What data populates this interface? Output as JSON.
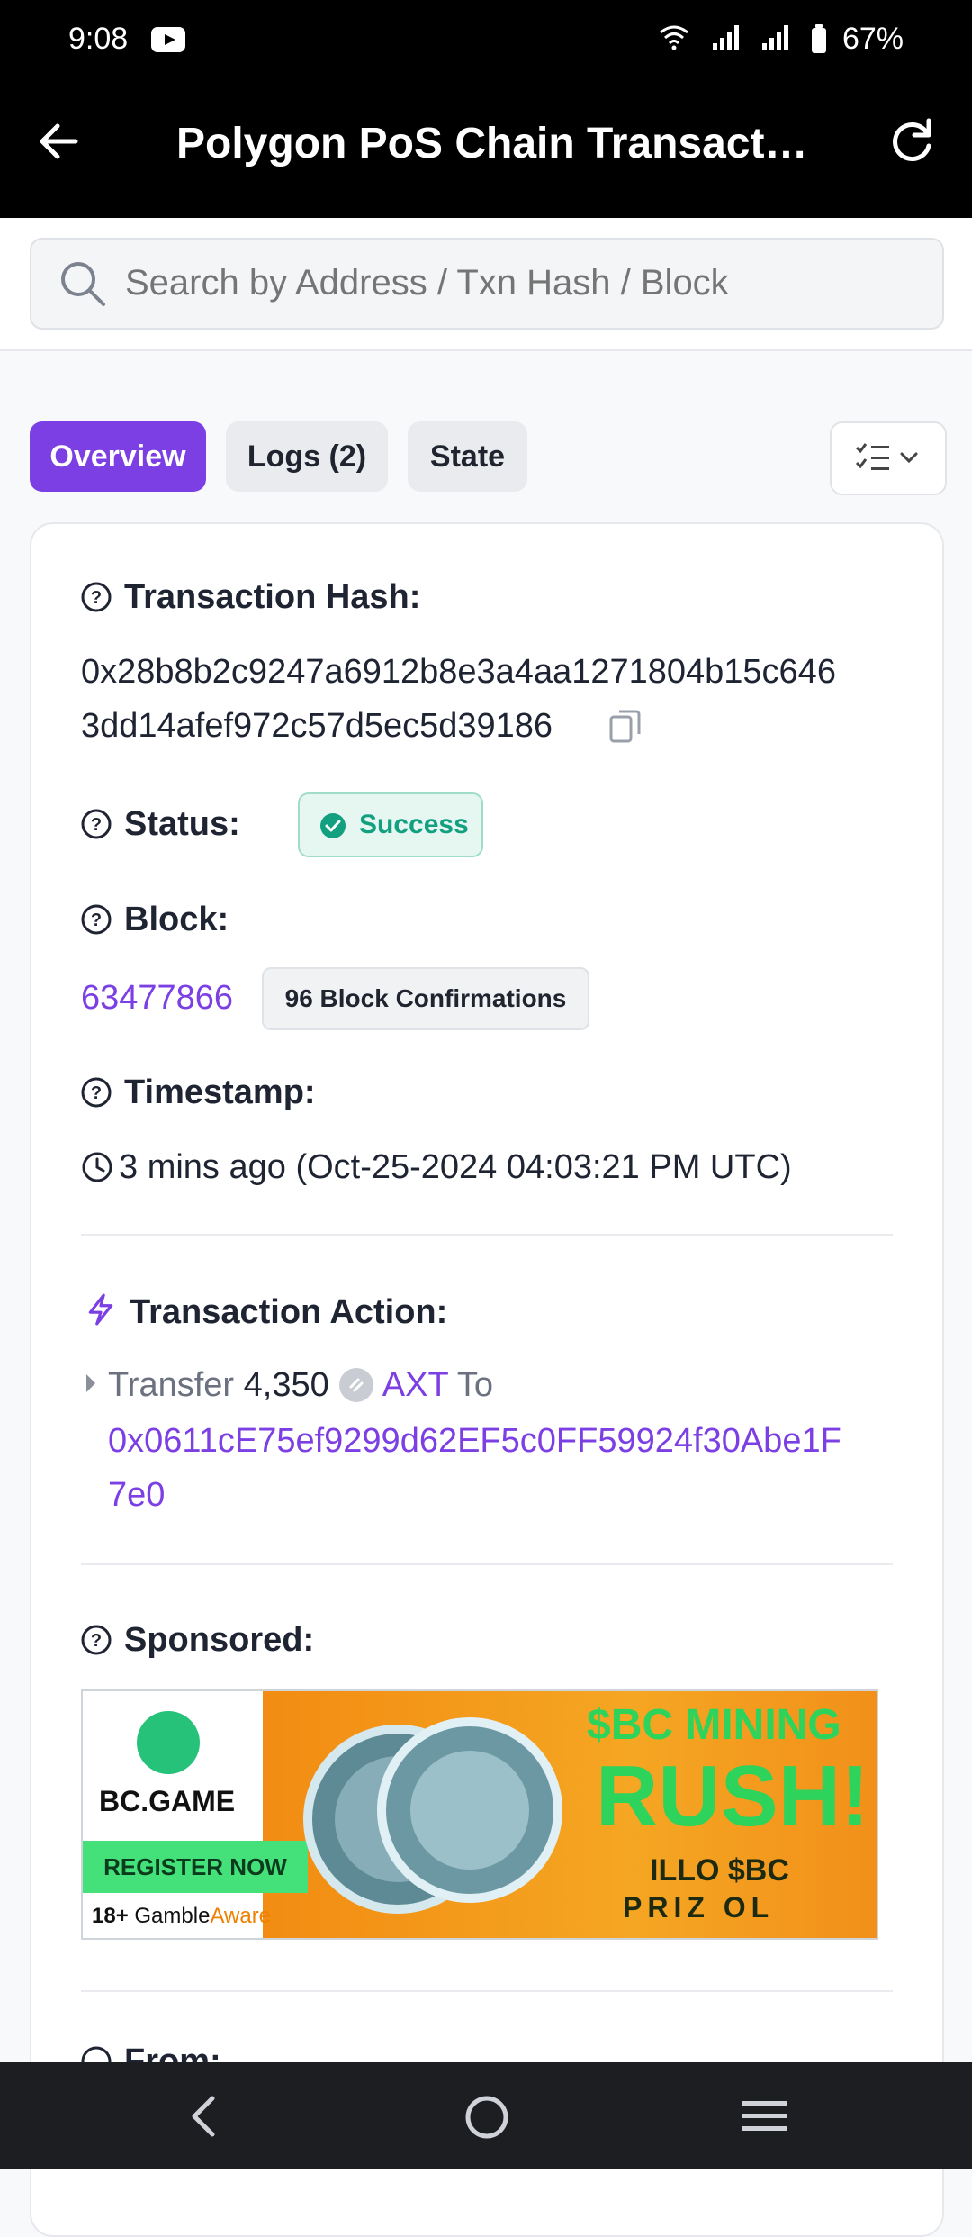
{
  "status_bar": {
    "time": "9:08",
    "battery": "67%"
  },
  "app_bar": {
    "title": "Polygon PoS Chain Transactio..."
  },
  "search": {
    "placeholder": "Search by Address / Txn Hash / Block"
  },
  "tabs": [
    {
      "label": "Overview",
      "active": true
    },
    {
      "label": "Logs (2)",
      "active": false
    },
    {
      "label": "State",
      "active": false
    }
  ],
  "transaction": {
    "hash_label": "Transaction Hash:",
    "hash_line1": "0x28b8b2c9247a6912b8e3a4aa1271804b15c646",
    "hash_line2": "3dd14afef972c57d5ec5d39186",
    "status_label": "Status:",
    "status_value": "Success",
    "block_label": "Block:",
    "block_number": "63477866",
    "block_confirmations": "96 Block Confirmations",
    "timestamp_label": "Timestamp:",
    "timestamp_value": "3 mins ago (Oct-25-2024 04:03:21 PM UTC)",
    "action_label": "Transaction Action:",
    "action_verb": "Transfer",
    "action_amount": "4,350",
    "action_token": "AXT",
    "action_to_word": "To",
    "action_to_address_line1": "0x0611cE75ef9299d62EF5c0FF59924f30Abe1F",
    "action_to_address_line2": "7e0",
    "sponsored_label": "Sponsored:",
    "next_label_partial": "From:"
  },
  "ad": {
    "brand": "BC.GAME",
    "cta": "REGISTER NOW",
    "age": "18+",
    "gamble": "Gamble",
    "aware": "Aware",
    "headline1": "$BC MINING",
    "headline2": "RUSH!",
    "sub1": "ILLO $BC",
    "sub2": "PRIZ OL"
  },
  "colors": {
    "accent": "#7b3fe4",
    "success": "#12a080",
    "appbar": "#000000"
  }
}
